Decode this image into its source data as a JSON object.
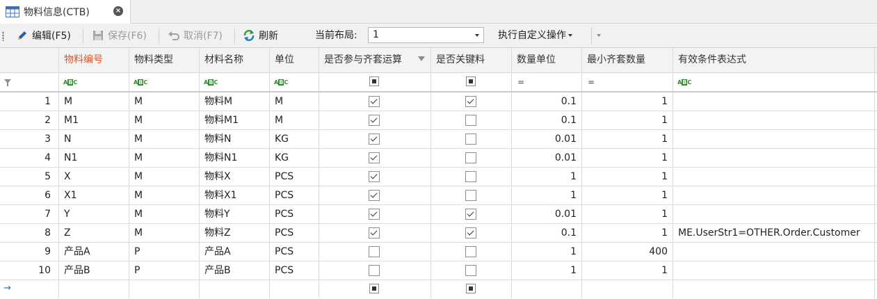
{
  "tab": {
    "title": "物料信息(CTB)"
  },
  "toolbar": {
    "edit": "编辑(F5)",
    "save": "保存(F6)",
    "cancel": "取消(F7)",
    "refresh": "刷新",
    "layout_label": "当前布局:",
    "layout_value": "1",
    "custom_op": "执行自定义操作"
  },
  "columns": [
    "物料编号",
    "物料类型",
    "材料名称",
    "单位",
    "是否参与齐套运算",
    "是否关键料",
    "数量单位",
    "最小齐套数量",
    "有效条件表达式"
  ],
  "rows": [
    {
      "n": "1",
      "code": "M",
      "type": "M",
      "name": "物料M",
      "unit": "M",
      "calc": true,
      "key": true,
      "qty_unit": "0.1",
      "min_qty": "1",
      "expr": ""
    },
    {
      "n": "2",
      "code": "M1",
      "type": "M",
      "name": "物料M1",
      "unit": "M",
      "calc": true,
      "key": false,
      "qty_unit": "0.1",
      "min_qty": "1",
      "expr": ""
    },
    {
      "n": "3",
      "code": "N",
      "type": "M",
      "name": "物料N",
      "unit": "KG",
      "calc": true,
      "key": false,
      "qty_unit": "0.01",
      "min_qty": "1",
      "expr": ""
    },
    {
      "n": "4",
      "code": "N1",
      "type": "M",
      "name": "物料N1",
      "unit": "KG",
      "calc": true,
      "key": false,
      "qty_unit": "0.01",
      "min_qty": "1",
      "expr": ""
    },
    {
      "n": "5",
      "code": "X",
      "type": "M",
      "name": "物料X",
      "unit": "PCS",
      "calc": true,
      "key": false,
      "qty_unit": "1",
      "min_qty": "1",
      "expr": ""
    },
    {
      "n": "6",
      "code": "X1",
      "type": "M",
      "name": "物料X1",
      "unit": "PCS",
      "calc": true,
      "key": false,
      "qty_unit": "1",
      "min_qty": "1",
      "expr": ""
    },
    {
      "n": "7",
      "code": "Y",
      "type": "M",
      "name": "物料Y",
      "unit": "PCS",
      "calc": true,
      "key": true,
      "qty_unit": "0.01",
      "min_qty": "1",
      "expr": ""
    },
    {
      "n": "8",
      "code": "Z",
      "type": "M",
      "name": "物料Z",
      "unit": "PCS",
      "calc": true,
      "key": true,
      "qty_unit": "0.1",
      "min_qty": "1",
      "expr": "ME.UserStr1=OTHER.Order.Customer"
    },
    {
      "n": "9",
      "code": "产品A",
      "type": "P",
      "name": "产品A",
      "unit": "PCS",
      "calc": false,
      "key": false,
      "qty_unit": "1",
      "min_qty": "400",
      "expr": ""
    },
    {
      "n": "10",
      "code": "产品B",
      "type": "P",
      "name": "产品B",
      "unit": "PCS",
      "calc": false,
      "key": false,
      "qty_unit": "1",
      "min_qty": "1",
      "expr": ""
    }
  ],
  "filter_ops": {
    "abc": "ABC",
    "eq": "="
  },
  "new_row_marker": "→",
  "icons": [
    "table-icon",
    "close-icon",
    "pencil-icon",
    "save-icon",
    "undo-icon",
    "refresh-icon",
    "funnel-icon",
    "filter-type-icon",
    "checkbox-icon",
    "arrow-right-icon"
  ]
}
